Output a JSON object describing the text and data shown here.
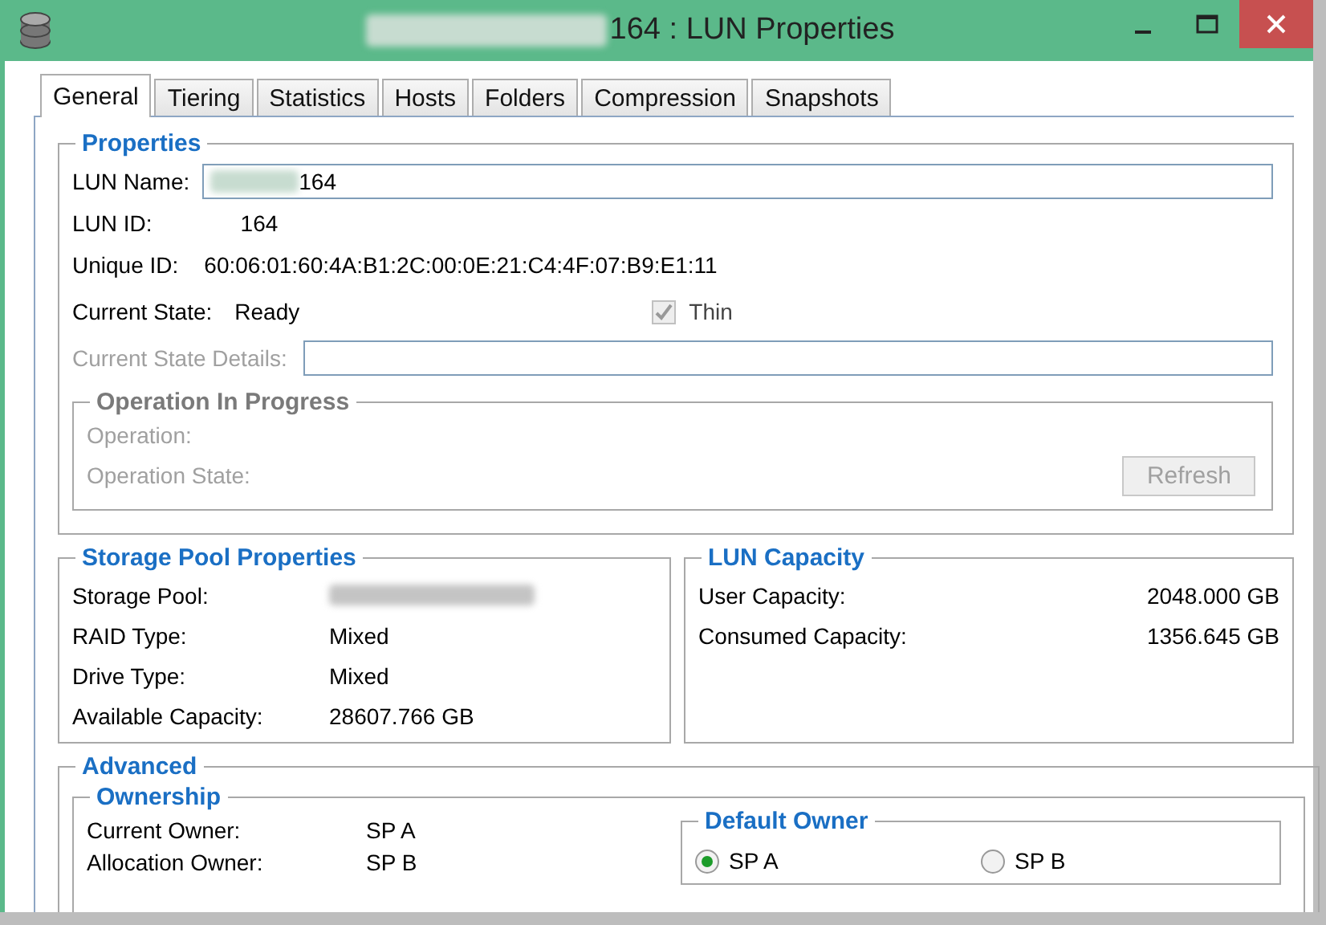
{
  "window": {
    "title": "164 : LUN Properties"
  },
  "tabs": [
    {
      "label": "General",
      "selected": true
    },
    {
      "label": "Tiering",
      "selected": false
    },
    {
      "label": "Statistics",
      "selected": false
    },
    {
      "label": "Hosts",
      "selected": false
    },
    {
      "label": "Folders",
      "selected": false
    },
    {
      "label": "Compression",
      "selected": false
    },
    {
      "label": "Snapshots",
      "selected": false
    }
  ],
  "properties": {
    "title": "Properties",
    "fields": [
      {
        "kind": "input",
        "label": "LUN Name:",
        "value": "164"
      },
      {
        "kind": "text",
        "label": "LUN ID:",
        "value": "164"
      },
      {
        "kind": "text",
        "label": "Unique ID:",
        "value": "60:06:01:60:4A:B1:2C:00:0E:21:C4:4F:07:B9:E1:11"
      }
    ],
    "current_state": {
      "label": "Current State:",
      "value": "Ready"
    },
    "thin": {
      "label": "Thin",
      "checked": true,
      "disabled": true
    },
    "current_state_details": {
      "label": "Current State Details:",
      "disabled": true
    },
    "operation_in_progress": {
      "title": "Operation In Progress",
      "disabled": true,
      "fields": [
        "Operation:",
        "Operation State:"
      ],
      "refresh_button": {
        "label": "Refresh",
        "disabled": true
      }
    }
  },
  "storage_pool_properties": {
    "title": "Storage Pool Properties",
    "rows": [
      {
        "label": "Storage Pool:"
      },
      {
        "label": "RAID Type:",
        "value": "Mixed"
      },
      {
        "label": "Drive Type:",
        "value": "Mixed"
      },
      {
        "label": "Available Capacity:",
        "value": "28607.766 GB"
      }
    ]
  },
  "lun_capacity": {
    "title": "LUN Capacity",
    "rows": [
      {
        "label": "User Capacity:",
        "value": "2048.000 GB"
      },
      {
        "label": "Consumed Capacity:",
        "value": "1356.645 GB"
      }
    ]
  },
  "advanced": {
    "title": "Advanced",
    "ownership": {
      "title": "Ownership",
      "rows": [
        {
          "label": "Current Owner:",
          "value": "SP A"
        },
        {
          "label": "Allocation Owner:",
          "value": "SP B"
        }
      ]
    },
    "default_owner": {
      "title": "Default Owner",
      "options": [
        {
          "label": "SP A",
          "selected": true
        },
        {
          "label": "SP B",
          "selected": false
        }
      ]
    }
  }
}
